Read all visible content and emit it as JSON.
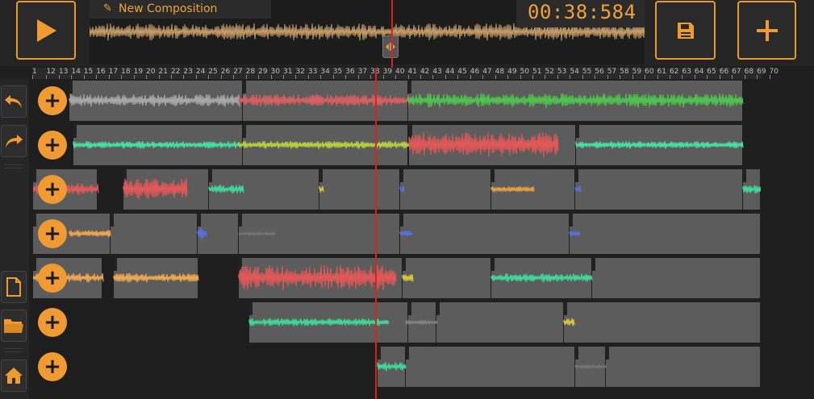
{
  "composition": {
    "title": "New Composition",
    "time": "00:38:584"
  },
  "ruler": {
    "ticks": [
      "1",
      "12",
      "13",
      "14",
      "15",
      "16",
      "17",
      "18",
      "19",
      "20",
      "21",
      "22",
      "23",
      "24",
      "25",
      "26",
      "27",
      "28",
      "29",
      "30",
      "31",
      "32",
      "33",
      "34",
      "35",
      "36",
      "37",
      "38",
      "39",
      "40",
      "41",
      "42",
      "43",
      "44",
      "45",
      "46",
      "47",
      "48",
      "49",
      "50",
      "51",
      "52",
      "53",
      "54",
      "55",
      "56",
      "57",
      "58",
      "59",
      "60",
      "61",
      "62",
      "63",
      "64",
      "65",
      "66",
      "67",
      "68",
      "69",
      "70"
    ]
  },
  "colors": {
    "accent": "#f09a33",
    "playhead": "#d9231f",
    "clip": "#5c5c5c",
    "background": "#1f1f1f"
  },
  "icons": {
    "play": "play-icon",
    "save": "save-icon",
    "add": "plus-icon",
    "undo": "undo-icon",
    "redo": "redo-icon",
    "new_file": "new-file-icon",
    "open_folder": "folder-icon",
    "home": "home-icon",
    "pencil": "pencil-icon"
  },
  "tracks": [
    {
      "add_label": "+"
    },
    {
      "add_label": "+"
    },
    {
      "add_label": "+"
    },
    {
      "add_label": "+"
    },
    {
      "add_label": "+"
    },
    {
      "add_label": "+"
    },
    {
      "add_label": "+"
    }
  ]
}
